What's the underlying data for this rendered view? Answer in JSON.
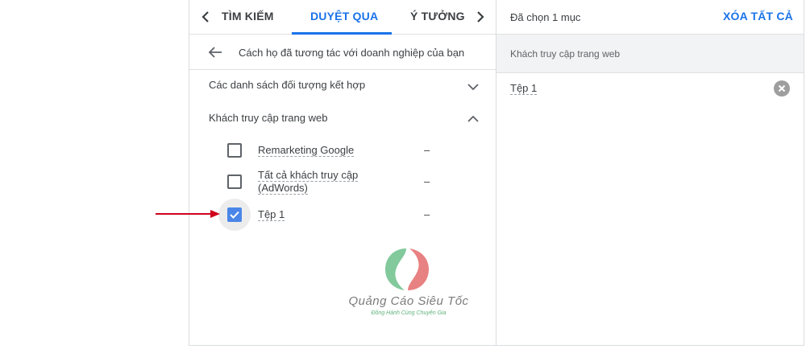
{
  "tabs": {
    "items": [
      {
        "label": "TÌM KIẾM",
        "active": false
      },
      {
        "label": "DUYỆT QUA",
        "active": true
      },
      {
        "label": "Ý TƯỞNG",
        "active": false
      }
    ]
  },
  "breadcrumb": {
    "title": "Cách họ đã tương tác với doanh nghiệp của bạn"
  },
  "sections": {
    "combined": {
      "label": "Các danh sách đối tượng kết hợp",
      "expanded": false
    },
    "website_visitors": {
      "label": "Khách truy cập trang web",
      "expanded": true
    }
  },
  "audience_items": [
    {
      "label": "Remarketing Google",
      "value": "–",
      "checked": false
    },
    {
      "label_line1": "Tất cả khách truy cập",
      "label_line2": "(AdWords)",
      "value": "–",
      "checked": false
    },
    {
      "label": "Tệp 1",
      "value": "–",
      "checked": true
    }
  ],
  "watermark": {
    "title": "Quảng Cáo Siêu Tốc",
    "subtitle": "Đồng Hành Cùng Chuyên Gia"
  },
  "selection": {
    "count_label": "Đã chọn 1 mục",
    "clear_label": "XÓA TẤT CẢ",
    "group_label": "Khách truy cập trang web",
    "items": [
      {
        "label": "Tệp 1"
      }
    ]
  },
  "colors": {
    "accent": "#1a73e8",
    "checkbox": "#4a86e8",
    "annotation_arrow": "#d0021b"
  }
}
